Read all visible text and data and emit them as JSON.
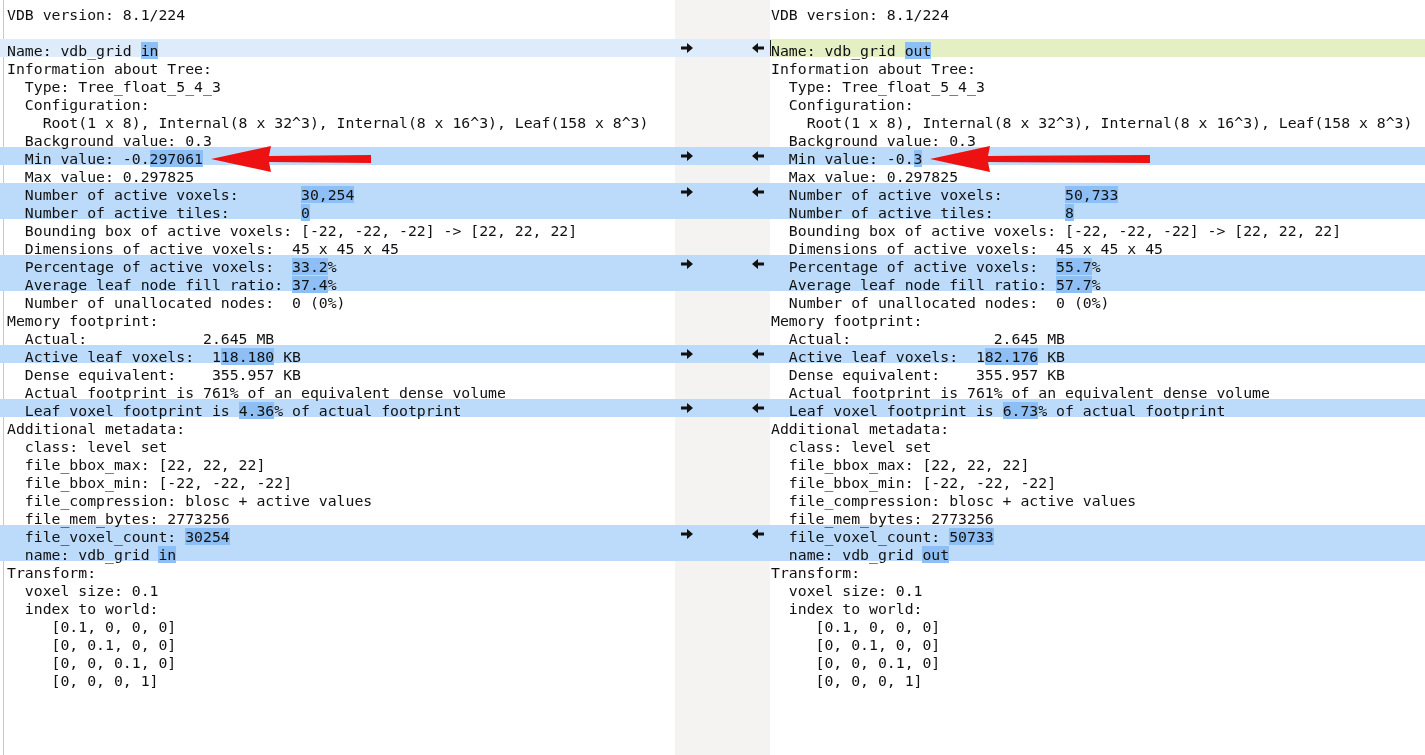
{
  "chunks": [
    {
      "kind": "equal",
      "left": [
        {
          "segments": [
            "VDB version: 8.1/224"
          ]
        }
      ],
      "right": [
        {
          "segments": [
            "VDB version: 8.1/224"
          ]
        }
      ]
    },
    {
      "kind": "replace",
      "selected": true,
      "left": [
        {
          "segments": [
            "Name: vdb_grid ",
            {
              "text": "in",
              "changed": true
            }
          ]
        }
      ],
      "right": [
        {
          "segments": [
            "Name: vdb_grid ",
            {
              "text": "out",
              "changed": true
            }
          ]
        }
      ]
    },
    {
      "kind": "equal",
      "left": [
        {
          "segments": [
            "Information about Tree:"
          ]
        },
        {
          "segments": [
            "  Type: Tree_float_5_4_3"
          ]
        },
        {
          "segments": [
            "  Configuration:"
          ]
        },
        {
          "segments": [
            "    Root(1 x 8), Internal(8 x 32^3), Internal(8 x 16^3), Leaf(158 x 8^3)"
          ]
        },
        {
          "segments": [
            "  Background value: 0.3"
          ]
        }
      ],
      "right": [
        {
          "segments": [
            "Information about Tree:"
          ]
        },
        {
          "segments": [
            "  Type: Tree_float_5_4_3"
          ]
        },
        {
          "segments": [
            "  Configuration:"
          ]
        },
        {
          "segments": [
            "    Root(1 x 8), Internal(8 x 32^3), Internal(8 x 16^3), Leaf(158 x 8^3)"
          ]
        },
        {
          "segments": [
            "  Background value: 0.3"
          ]
        }
      ]
    },
    {
      "kind": "replace",
      "selected": false,
      "left": [
        {
          "segments": [
            "  Min value: -0.",
            {
              "text": "297061",
              "changed": true
            }
          ],
          "annotated": true
        }
      ],
      "right": [
        {
          "segments": [
            "  Min value: -0.",
            {
              "text": "3",
              "changed": true
            }
          ],
          "annotated": true
        }
      ]
    },
    {
      "kind": "equal",
      "left": [
        {
          "segments": [
            "  Max value: 0.297825"
          ]
        }
      ],
      "right": [
        {
          "segments": [
            "  Max value: 0.297825"
          ]
        }
      ]
    },
    {
      "kind": "replace",
      "selected": false,
      "left": [
        {
          "segments": [
            "  Number of active voxels:       ",
            {
              "text": "30,254",
              "changed": true
            }
          ]
        },
        {
          "segments": [
            "  Number of active tiles:        ",
            {
              "text": "0",
              "changed": true
            }
          ]
        }
      ],
      "right": [
        {
          "segments": [
            "  Number of active voxels:       ",
            {
              "text": "50,733",
              "changed": true
            }
          ]
        },
        {
          "segments": [
            "  Number of active tiles:        ",
            {
              "text": "8",
              "changed": true
            }
          ]
        }
      ]
    },
    {
      "kind": "equal",
      "left": [
        {
          "segments": [
            "  Bounding box of active voxels: [-22, -22, -22] -> [22, 22, 22]"
          ]
        },
        {
          "segments": [
            "  Dimensions of active voxels:  45 x 45 x 45"
          ]
        }
      ],
      "right": [
        {
          "segments": [
            "  Bounding box of active voxels: [-22, -22, -22] -> [22, 22, 22]"
          ]
        },
        {
          "segments": [
            "  Dimensions of active voxels:  45 x 45 x 45"
          ]
        }
      ]
    },
    {
      "kind": "replace",
      "selected": false,
      "left": [
        {
          "segments": [
            "  Percentage of active voxels:  ",
            {
              "text": "33.2",
              "changed": true
            },
            "%"
          ]
        },
        {
          "segments": [
            "  Average leaf node fill ratio: ",
            {
              "text": "37.4",
              "changed": true
            },
            "%"
          ]
        }
      ],
      "right": [
        {
          "segments": [
            "  Percentage of active voxels:  ",
            {
              "text": "55.7",
              "changed": true
            },
            "%"
          ]
        },
        {
          "segments": [
            "  Average leaf node fill ratio: ",
            {
              "text": "57.7",
              "changed": true
            },
            "%"
          ]
        }
      ]
    },
    {
      "kind": "equal",
      "left": [
        {
          "segments": [
            "  Number of unallocated nodes:  0 (0%)"
          ]
        },
        {
          "segments": [
            "Memory footprint:"
          ]
        },
        {
          "segments": [
            "  Actual:             2.645 MB"
          ]
        }
      ],
      "right": [
        {
          "segments": [
            "  Number of unallocated nodes:  0 (0%)"
          ]
        },
        {
          "segments": [
            "Memory footprint:"
          ]
        },
        {
          "segments": [
            "  Actual:                2.645 MB"
          ]
        }
      ]
    },
    {
      "kind": "replace",
      "selected": false,
      "left": [
        {
          "segments": [
            "  Active leaf voxels:  1",
            {
              "text": "18.180",
              "changed": true
            },
            " KB"
          ]
        }
      ],
      "right": [
        {
          "segments": [
            "  Active leaf voxels:  1",
            {
              "text": "82.176",
              "changed": true
            },
            " KB"
          ]
        }
      ]
    },
    {
      "kind": "equal",
      "left": [
        {
          "segments": [
            "  Dense equivalent:    355.957 KB"
          ]
        },
        {
          "segments": [
            "  Actual footprint is 761% of an equivalent dense volume"
          ]
        }
      ],
      "right": [
        {
          "segments": [
            "  Dense equivalent:    355.957 KB"
          ]
        },
        {
          "segments": [
            "  Actual footprint is 761% of an equivalent dense volume"
          ]
        }
      ]
    },
    {
      "kind": "replace",
      "selected": false,
      "left": [
        {
          "segments": [
            "  Leaf voxel footprint is ",
            {
              "text": "4.36",
              "changed": true
            },
            "% of actual footprint"
          ]
        }
      ],
      "right": [
        {
          "segments": [
            "  Leaf voxel footprint is ",
            {
              "text": "6.73",
              "changed": true
            },
            "% of actual footprint"
          ]
        }
      ]
    },
    {
      "kind": "equal",
      "left": [
        {
          "segments": [
            "Additional metadata:"
          ]
        },
        {
          "segments": [
            "  class: level set"
          ]
        },
        {
          "segments": [
            "  file_bbox_max: [22, 22, 22]"
          ]
        },
        {
          "segments": [
            "  file_bbox_min: [-22, -22, -22]"
          ]
        },
        {
          "segments": [
            "  file_compression: blosc + active values"
          ]
        },
        {
          "segments": [
            "  file_mem_bytes: 2773256"
          ]
        }
      ],
      "right": [
        {
          "segments": [
            "Additional metadata:"
          ]
        },
        {
          "segments": [
            "  class: level set"
          ]
        },
        {
          "segments": [
            "  file_bbox_max: [22, 22, 22]"
          ]
        },
        {
          "segments": [
            "  file_bbox_min: [-22, -22, -22]"
          ]
        },
        {
          "segments": [
            "  file_compression: blosc + active values"
          ]
        },
        {
          "segments": [
            "  file_mem_bytes: 2773256"
          ]
        }
      ]
    },
    {
      "kind": "replace",
      "selected": false,
      "left": [
        {
          "segments": [
            "  file_voxel_count: ",
            {
              "text": "30254",
              "changed": true
            }
          ]
        },
        {
          "segments": [
            "  name: vdb_grid ",
            {
              "text": "in",
              "changed": true
            }
          ]
        }
      ],
      "right": [
        {
          "segments": [
            "  file_voxel_count: ",
            {
              "text": "50733",
              "changed": true
            }
          ]
        },
        {
          "segments": [
            "  name: vdb_grid ",
            {
              "text": "out",
              "changed": true
            }
          ]
        }
      ]
    },
    {
      "kind": "equal",
      "left": [
        {
          "segments": [
            "Transform:"
          ]
        },
        {
          "segments": [
            "  voxel size: 0.1"
          ]
        },
        {
          "segments": [
            "  index to world:"
          ]
        },
        {
          "segments": [
            "     [0.1, 0, 0, 0]"
          ]
        },
        {
          "segments": [
            "     [0, 0.1, 0, 0]"
          ]
        },
        {
          "segments": [
            "     [0, 0, 0.1, 0]"
          ]
        },
        {
          "segments": [
            "     [0, 0, 0, 1]"
          ]
        }
      ],
      "right": [
        {
          "segments": [
            "Transform:"
          ]
        },
        {
          "segments": [
            "  voxel size: 0.1"
          ]
        },
        {
          "segments": [
            "  index to world:"
          ]
        },
        {
          "segments": [
            "     [0.1, 0, 0, 0]"
          ]
        },
        {
          "segments": [
            "     [0, 0.1, 0, 0]"
          ]
        },
        {
          "segments": [
            "     [0, 0, 0.1, 0]"
          ]
        },
        {
          "segments": [
            "     [0, 0, 0, 1]"
          ]
        }
      ]
    }
  ]
}
